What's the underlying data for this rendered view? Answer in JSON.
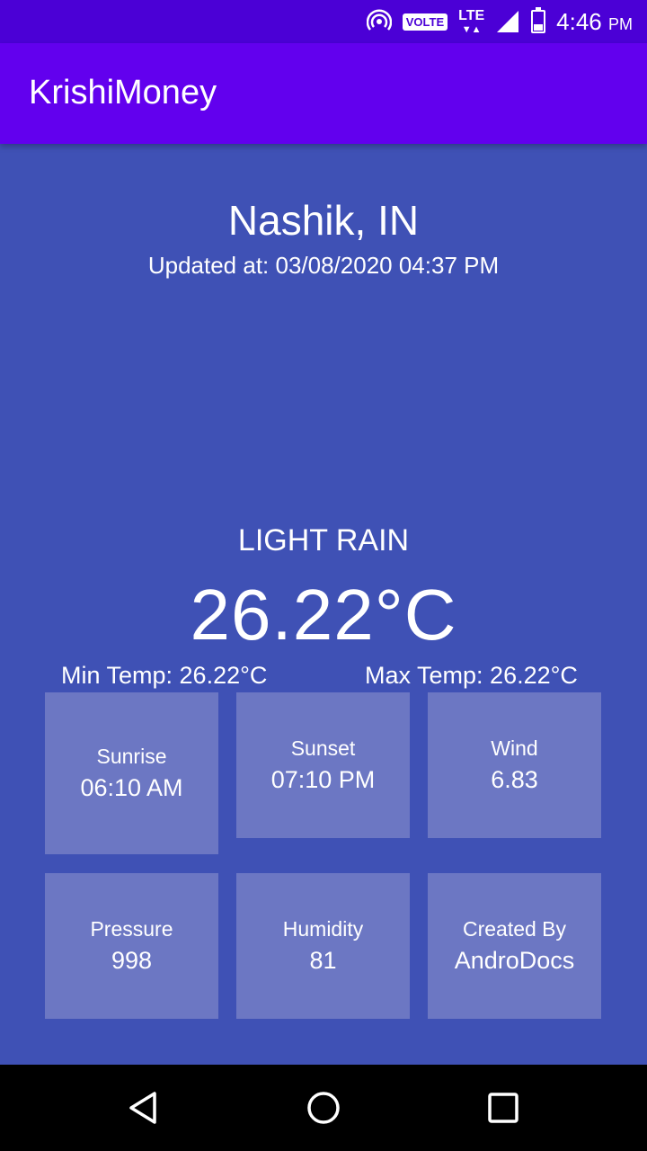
{
  "status_bar": {
    "volte": "VOLTE",
    "lte": "LTE",
    "time": "4:46",
    "ampm": "PM"
  },
  "app_bar": {
    "title": "KrishiMoney"
  },
  "weather": {
    "city": "Nashik, IN",
    "updated": "Updated at: 03/08/2020 04:37 PM",
    "description": "LIGHT RAIN",
    "temperature": "26.22°C",
    "min_temp": "Min Temp: 26.22°C",
    "max_temp": "Max Temp: 26.22°C"
  },
  "tiles": [
    {
      "label": "Sunrise",
      "value": "06:10 AM"
    },
    {
      "label": "Sunset",
      "value": "07:10 PM"
    },
    {
      "label": "Wind",
      "value": "6.83"
    },
    {
      "label": "Pressure",
      "value": "998"
    },
    {
      "label": "Humidity",
      "value": "81"
    },
    {
      "label": "Created By",
      "value": "AndroDocs"
    }
  ],
  "colors": {
    "status_bar": "#4b00d6",
    "app_bar": "#6200ee",
    "background": "#3f51b5",
    "tile": "#6c77c3"
  },
  "icons": [
    "hotspot-icon",
    "signal-icon",
    "battery-icon",
    "back-icon",
    "home-icon",
    "recents-icon"
  ]
}
